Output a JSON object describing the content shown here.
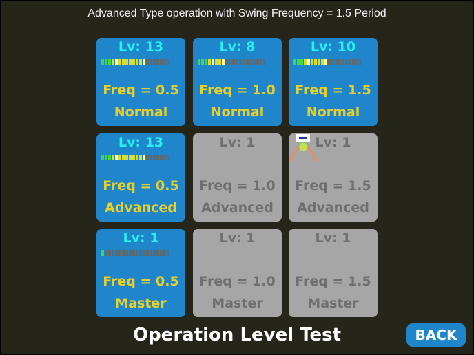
{
  "header": "Advanced Type operation with Swing Frequency = 1.5 Period",
  "title": "Operation Level Test",
  "back_label": "BACK",
  "colors": {
    "background": "#26251a",
    "card_active": "#1f86cc",
    "card_locked": "#a6a6a6",
    "level_text_active": "#27f0f0",
    "text_active": "#e8cf2a",
    "text_locked": "#6f6f6f"
  },
  "cards": [
    {
      "level": "Lv: 13",
      "freq": "Freq = 0.5",
      "mode": "Normal",
      "state": "active",
      "progress": 13,
      "max": 20
    },
    {
      "level": "Lv: 8",
      "freq": "Freq = 1.0",
      "mode": "Normal",
      "state": "active",
      "progress": 8,
      "max": 20
    },
    {
      "level": "Lv: 10",
      "freq": "Freq = 1.5",
      "mode": "Normal",
      "state": "active",
      "progress": 10,
      "max": 20
    },
    {
      "level": "Lv: 13",
      "freq": "Freq = 0.5",
      "mode": "Advanced",
      "state": "active",
      "progress": 13,
      "max": 20
    },
    {
      "level": "Lv: 1",
      "freq": "Freq = 1.0",
      "mode": "Advanced",
      "state": "locked"
    },
    {
      "level": "Lv: 1",
      "freq": "Freq = 1.5",
      "mode": "Advanced",
      "state": "locked"
    },
    {
      "level": "Lv: 1",
      "freq": "Freq = 0.5",
      "mode": "Master",
      "state": "active",
      "progress": 1,
      "max": 20
    },
    {
      "level": "Lv: 1",
      "freq": "Freq = 1.0",
      "mode": "Master",
      "state": "locked"
    },
    {
      "level": "Lv: 1",
      "freq": "Freq = 1.5",
      "mode": "Master",
      "state": "locked"
    }
  ],
  "cursor_icon": "robot-arm-icon"
}
